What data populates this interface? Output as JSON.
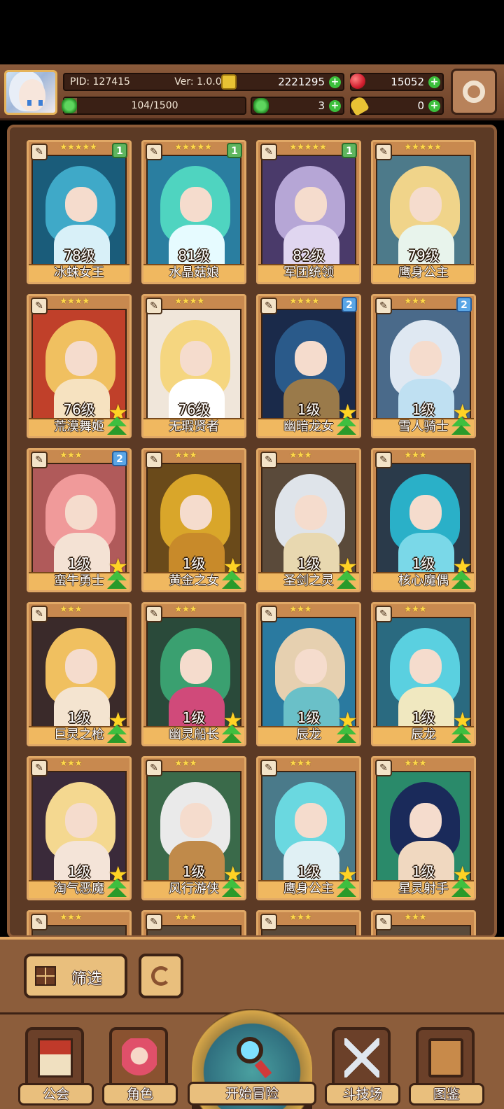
{
  "player": {
    "pid": "PID: 127415",
    "version": "Ver: 1.0.0.9",
    "exp": "104/1500",
    "exp_fraction": 0.069
  },
  "currency": {
    "gold": "2221295",
    "gems": "15052",
    "clover": "3",
    "keys": "0"
  },
  "cards": [
    {
      "name": "冰蛛女王",
      "level": "78级",
      "stars": "★★★★★",
      "badge": "1",
      "badge_color": "green",
      "colors": [
        "#3fa9c8",
        "#1a5c7a",
        "#d8f0f8"
      ],
      "upgrade": false
    },
    {
      "name": "水晶菇娘",
      "level": "81级",
      "stars": "★★★★★",
      "badge": "1",
      "badge_color": "green",
      "colors": [
        "#4fd4c0",
        "#2a7ea0",
        "#e6fbff"
      ],
      "upgrade": false
    },
    {
      "name": "军团统领",
      "level": "82级",
      "stars": "★★★★★",
      "badge": "1",
      "badge_color": "green",
      "colors": [
        "#b6a6d6",
        "#4a3a6a",
        "#e0d6f0"
      ],
      "upgrade": false
    },
    {
      "name": "鹰身公主",
      "level": "79级",
      "stars": "★★★★★",
      "badge": "",
      "badge_color": "",
      "colors": [
        "#f0d48a",
        "#4d7a8a",
        "#e8f4ec"
      ],
      "upgrade": false
    },
    {
      "name": "荒漠舞姬",
      "level": "76级",
      "stars": "★★★★",
      "badge": "",
      "badge_color": "",
      "colors": [
        "#f0c060",
        "#c0402a",
        "#f6e2c0"
      ],
      "upgrade": true
    },
    {
      "name": "无瑕贤者",
      "level": "76级",
      "stars": "★★★★",
      "badge": "",
      "badge_color": "",
      "colors": [
        "#f5d680",
        "#f0e6da",
        "#ffffff"
      ],
      "upgrade": false
    },
    {
      "name": "幽暗龙女",
      "level": "1级",
      "stars": "★★★★",
      "badge": "2",
      "badge_color": "blue",
      "colors": [
        "#2a5a8a",
        "#1a2a4a",
        "#9a7a4a"
      ],
      "upgrade": true
    },
    {
      "name": "雪人骑士",
      "level": "1级",
      "stars": "★★★",
      "badge": "2",
      "badge_color": "blue",
      "colors": [
        "#dfe8f2",
        "#4a6a8a",
        "#bfe0f2"
      ],
      "upgrade": true
    },
    {
      "name": "蛮牛勇士",
      "level": "1级",
      "stars": "★★★",
      "badge": "2",
      "badge_color": "blue",
      "colors": [
        "#f09a9a",
        "#b05a5a",
        "#f4e2d4"
      ],
      "upgrade": true
    },
    {
      "name": "黄金之女",
      "level": "1级",
      "stars": "★★★",
      "badge": "",
      "badge_color": "",
      "colors": [
        "#d9a62a",
        "#6a4a1a",
        "#c88a2a"
      ],
      "upgrade": true
    },
    {
      "name": "圣剑之灵",
      "level": "1级",
      "stars": "★★★",
      "badge": "",
      "badge_color": "",
      "colors": [
        "#dfe4ea",
        "#5a4a3a",
        "#e8d8b0"
      ],
      "upgrade": true
    },
    {
      "name": "核心魔偶",
      "level": "1级",
      "stars": "★★★",
      "badge": "",
      "badge_color": "",
      "colors": [
        "#2ab0c8",
        "#2a3a4a",
        "#7ad8e8"
      ],
      "upgrade": true
    },
    {
      "name": "巨灵之枪",
      "level": "1级",
      "stars": "★★★",
      "badge": "",
      "badge_color": "",
      "colors": [
        "#f0c060",
        "#3a2a2a",
        "#f4e4d0"
      ],
      "upgrade": true
    },
    {
      "name": "幽灵船长",
      "level": "1级",
      "stars": "★★★",
      "badge": "",
      "badge_color": "",
      "colors": [
        "#3aa070",
        "#2a4a3a",
        "#d04a7a"
      ],
      "upgrade": true
    },
    {
      "name": "辰龙",
      "level": "1级",
      "stars": "★★★",
      "badge": "",
      "badge_color": "",
      "colors": [
        "#e6d0b0",
        "#2a7aa0",
        "#6ac0c8"
      ],
      "upgrade": true
    },
    {
      "name": "辰龙",
      "level": "1级",
      "stars": "★★★",
      "badge": "",
      "badge_color": "",
      "colors": [
        "#5ad0e0",
        "#2a6a80",
        "#f0e8c0"
      ],
      "upgrade": true
    },
    {
      "name": "淘气恶魔",
      "level": "1级",
      "stars": "★★★",
      "badge": "",
      "badge_color": "",
      "colors": [
        "#f4d890",
        "#3a2a3a",
        "#f4e4d8"
      ],
      "upgrade": true
    },
    {
      "name": "风行游侠",
      "level": "1级",
      "stars": "★★★",
      "badge": "",
      "badge_color": "",
      "colors": [
        "#eaeaea",
        "#3a6a4a",
        "#c08a4a"
      ],
      "upgrade": true
    },
    {
      "name": "鹰身公主",
      "level": "1级",
      "stars": "★★★",
      "badge": "",
      "badge_color": "",
      "colors": [
        "#6ad8e0",
        "#4a7a8a",
        "#e0f0f4"
      ],
      "upgrade": true
    },
    {
      "name": "星灵射手",
      "level": "1级",
      "stars": "★★★",
      "badge": "",
      "badge_color": "",
      "colors": [
        "#1a2a5a",
        "#2a8a6a",
        "#f0d8c0"
      ],
      "upgrade": true
    }
  ],
  "partial_cards_stars": [
    "★★★",
    "★★★",
    "★★★",
    "★★★"
  ],
  "filter": {
    "label": "筛选"
  },
  "nav": {
    "guild": "公会",
    "hero": "角色",
    "adventure": "开始冒险",
    "arena": "斗技场",
    "codex": "图鉴"
  }
}
